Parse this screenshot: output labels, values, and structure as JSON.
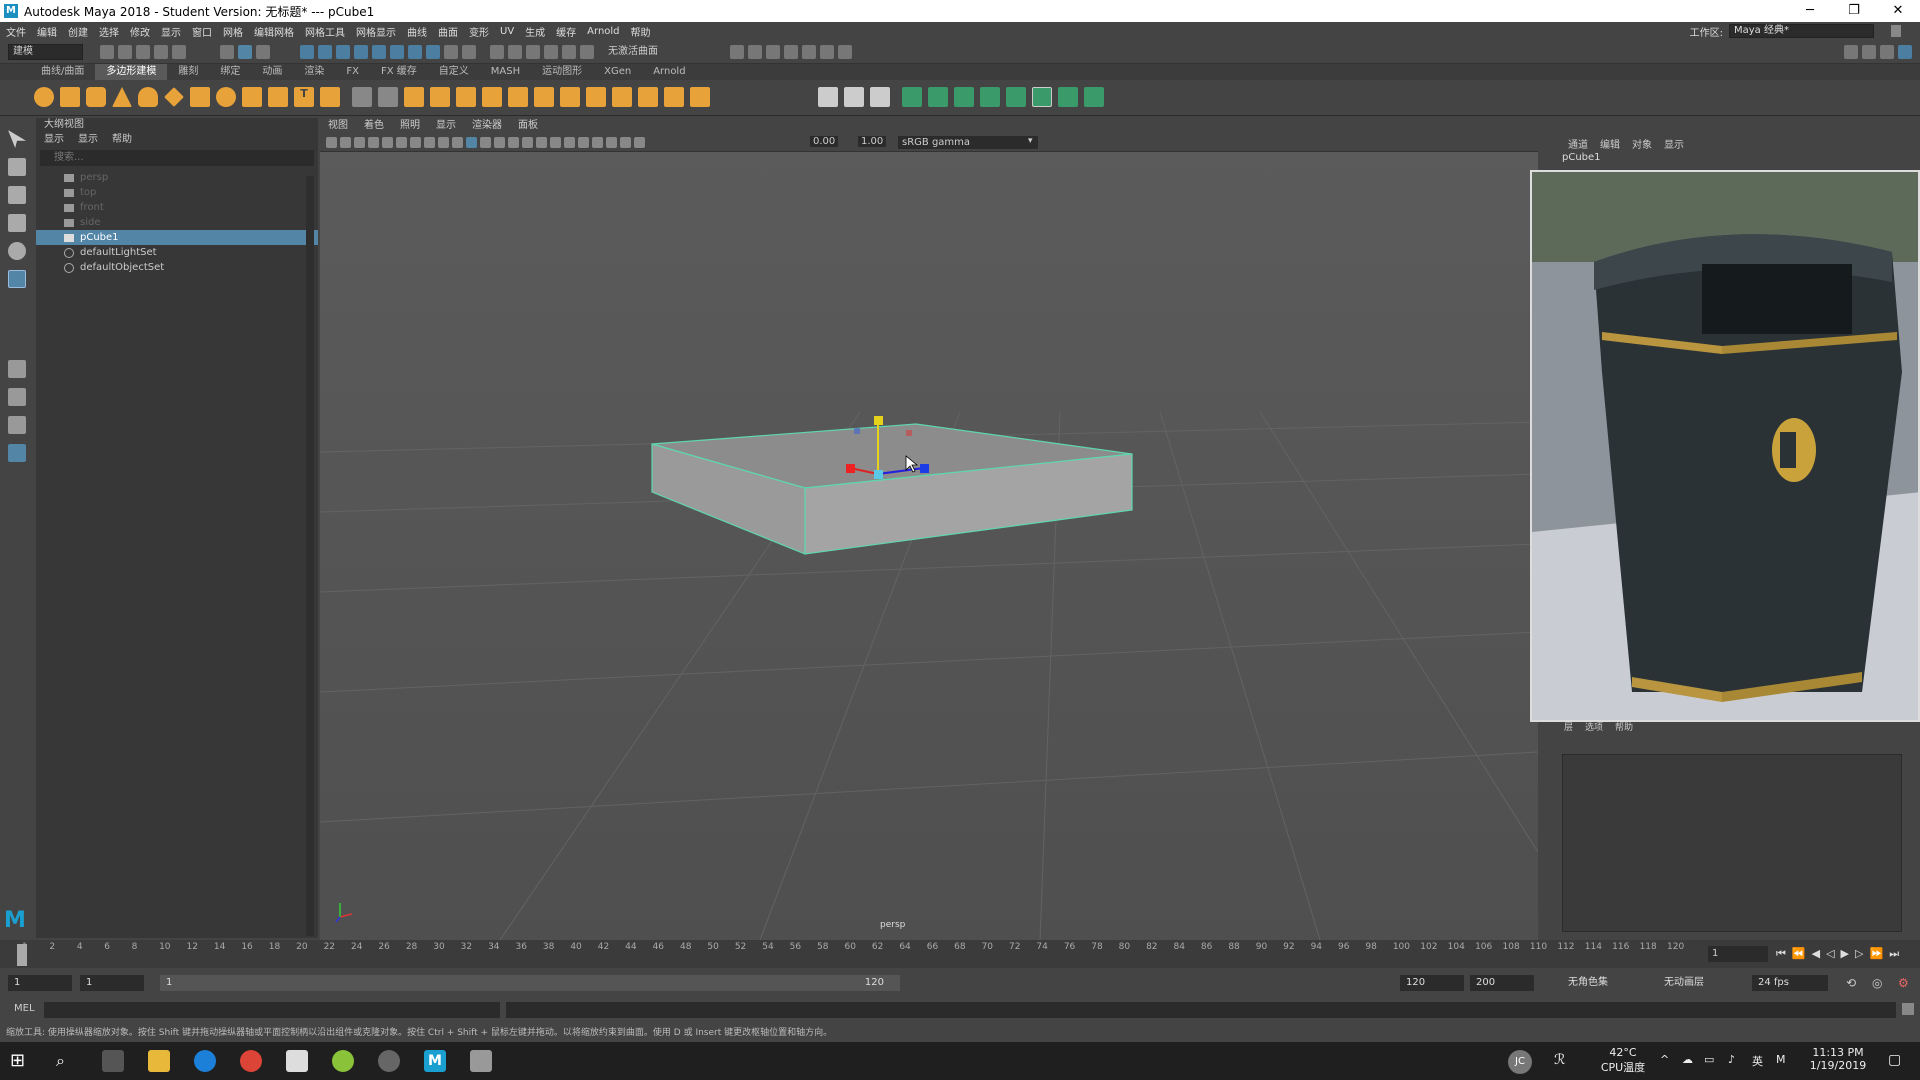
{
  "titlebar": {
    "icon_letter": "M",
    "title": "Autodesk Maya 2018 - Student Version: 无标题*  ---  pCube1"
  },
  "menubar": {
    "items": [
      "文件",
      "编辑",
      "创建",
      "选择",
      "修改",
      "显示",
      "窗口",
      "网格",
      "编辑网格",
      "网格工具",
      "网格显示",
      "曲线",
      "曲面",
      "变形",
      "UV",
      "生成",
      "缓存",
      "Arnold",
      "帮助"
    ],
    "workspace_label": "工作区:",
    "workspace_value": "Maya 经典*"
  },
  "statusline": {
    "mode": "建模",
    "live_surface": "无激活曲面"
  },
  "shelf_tabs": [
    "曲线/曲面",
    "多边形建模",
    "雕刻",
    "绑定",
    "动画",
    "渲染",
    "FX",
    "FX 缓存",
    "自定义",
    "MASH",
    "运动图形",
    "XGen",
    "Arnold"
  ],
  "shelf_active_index": 1,
  "outliner": {
    "title": "大纲视图",
    "menu": [
      "显示",
      "显示",
      "帮助"
    ],
    "search_placeholder": "搜索...",
    "items": [
      {
        "label": "persp",
        "dim": true,
        "type": "camera"
      },
      {
        "label": "top",
        "dim": true,
        "type": "camera"
      },
      {
        "label": "front",
        "dim": true,
        "type": "camera"
      },
      {
        "label": "side",
        "dim": true,
        "type": "camera"
      },
      {
        "label": "pCube1",
        "dim": false,
        "type": "mesh",
        "selected": true
      },
      {
        "label": "defaultLightSet",
        "dim": false,
        "type": "set"
      },
      {
        "label": "defaultObjectSet",
        "dim": false,
        "type": "set"
      }
    ]
  },
  "viewport": {
    "menu": [
      "视图",
      "着色",
      "照明",
      "显示",
      "渲染器",
      "面板"
    ],
    "exposure": "0.00",
    "gamma": "1.00",
    "color_space": "sRGB gamma",
    "camera_label": "persp"
  },
  "channelbox": {
    "menu": [
      "通道",
      "编辑",
      "对象",
      "显示"
    ],
    "object_name": "pCube1",
    "layer_menu": [
      "层",
      "选项",
      "帮助"
    ]
  },
  "timeline": {
    "ticks": [
      "1",
      "2",
      "4",
      "6",
      "8",
      "10",
      "12",
      "14",
      "16",
      "18",
      "20",
      "22",
      "24",
      "26",
      "28",
      "30",
      "32",
      "34",
      "36",
      "38",
      "40",
      "42",
      "44",
      "46",
      "48",
      "50",
      "52",
      "54",
      "56",
      "58",
      "60",
      "62",
      "64",
      "66",
      "68",
      "70",
      "72",
      "74",
      "76",
      "78",
      "80",
      "82",
      "84",
      "86",
      "88",
      "90",
      "92",
      "94",
      "96",
      "98",
      "100",
      "102",
      "104",
      "106",
      "108",
      "110",
      "112",
      "114",
      "116",
      "118",
      "120"
    ],
    "current_frame": "1"
  },
  "range": {
    "start": "1",
    "inner_start": "1",
    "slider_start": "1",
    "slider_end": "120",
    "end": "120",
    "max": "200",
    "char_set": "无角色集",
    "anim_layer": "无动画层",
    "fps": "24 fps"
  },
  "cmdline": {
    "lang": "MEL"
  },
  "helpline": {
    "text": "缩放工具: 使用操纵器缩放对象。按住 Shift 键并拖动操纵器轴或平面控制柄以沿出组件或克隆对象。按住 Ctrl + Shift + 鼠标左键并拖动。以将缩放约束到曲面。使用 D 或 Insert 键更改枢轴位置和轴方向。"
  },
  "taskbar": {
    "avatar": "JC",
    "temp": "42°C",
    "temp_label": "CPU温度",
    "ime": "英",
    "time": "11:13 PM",
    "date": "1/19/2019"
  },
  "colors": {
    "selection": "#5285a6",
    "wire": "#5fd6b0",
    "accent_shelf": "#e8a23a"
  }
}
